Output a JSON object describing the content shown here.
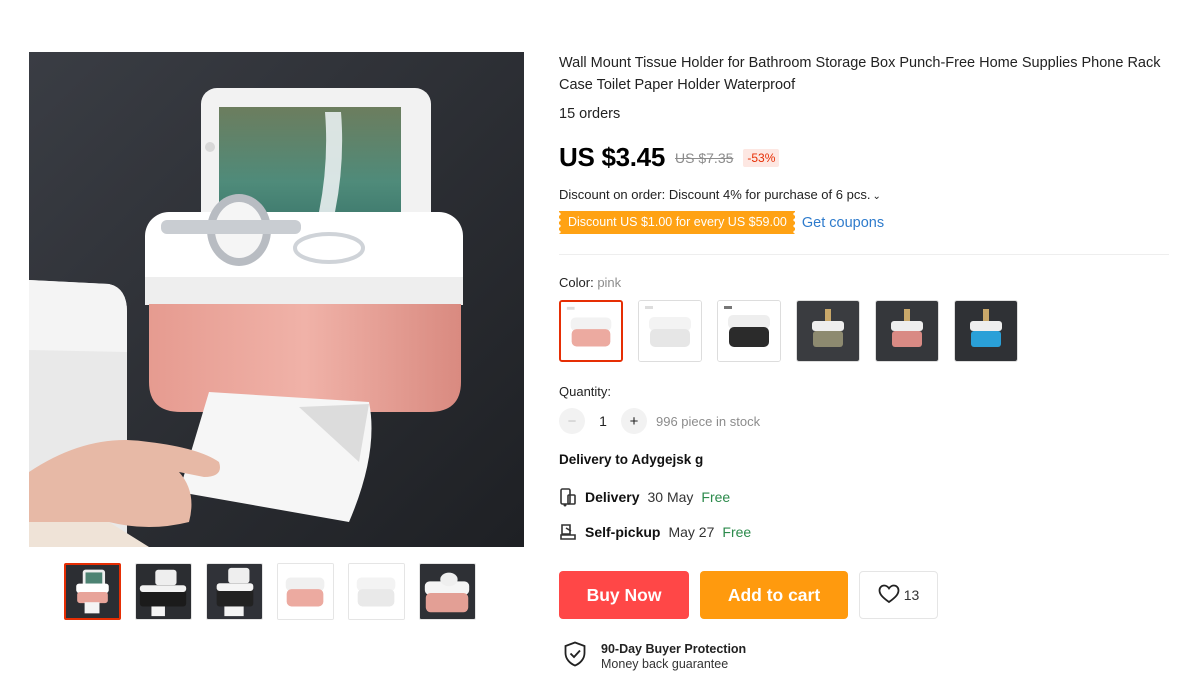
{
  "product": {
    "title": "Wall Mount Tissue Holder for Bathroom Storage Box Punch-Free Home Supplies Phone Rack Case Toilet Paper Holder Waterproof",
    "orders": "15 orders",
    "price": "US $3.45",
    "old_price": "US $7.35",
    "discount_pct": "-53%"
  },
  "discount": {
    "label": "Discount on order: Discount 4% for purchase of 6 pcs.",
    "coupon_badge": "Discount US $1.00 for every US $59.00",
    "get_coupons": "Get coupons"
  },
  "color": {
    "label": "Color:",
    "selected": "pink",
    "options": [
      "pink",
      "white",
      "black",
      "green deco",
      "pink deco",
      "blue deco"
    ]
  },
  "quantity": {
    "label": "Quantity:",
    "value": "1",
    "minus": "−",
    "plus": "+",
    "stock": "996 piece in stock"
  },
  "delivery": {
    "to": "Delivery to Adygejsk g",
    "delivery_label": "Delivery",
    "delivery_date": "30 May",
    "delivery_price": "Free",
    "pickup_label": "Self-pickup",
    "pickup_date": "May 27",
    "pickup_price": "Free"
  },
  "actions": {
    "buy_now": "Buy Now",
    "add_to_cart": "Add to cart",
    "wishlist_count": "13"
  },
  "protection": {
    "title": "90-Day Buyer Protection",
    "subtitle": "Money back guarantee"
  },
  "colors": {
    "accent_red": "#ff4747",
    "accent_orange": "#ff9a0e",
    "coupon_orange": "#ffa214",
    "link_blue": "#2e7bcc",
    "free_green": "#2b8a4b",
    "product_pink": "#e8a49a"
  }
}
